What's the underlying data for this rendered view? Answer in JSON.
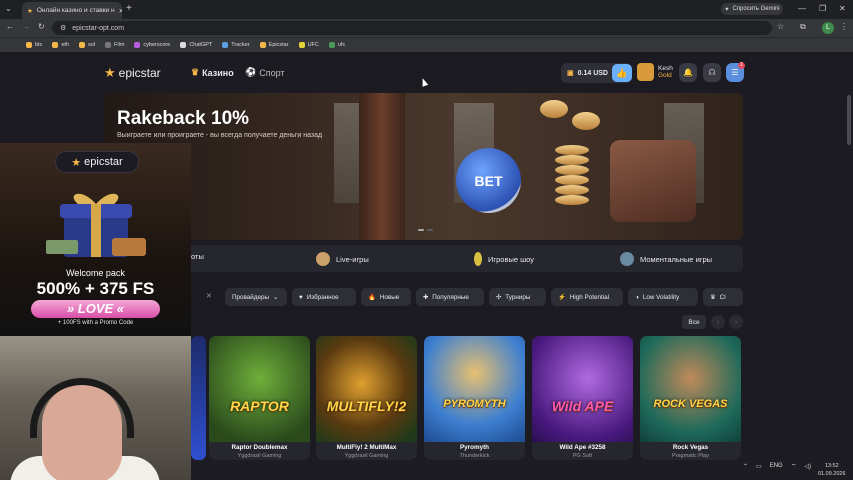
{
  "browser": {
    "tab_title": "Онлайн казино и ставки н",
    "url": "epicstar-opt.com",
    "gemini_label": "Спросить Gemini",
    "bookmarks": [
      "btc",
      "eth",
      "sol",
      "Film",
      "cyberscore",
      "ChatGPT",
      "Tracker",
      "Epicstar",
      "UFC",
      "ufc"
    ]
  },
  "site": {
    "logo": "epicstar",
    "nav": {
      "casino": "Казино",
      "sport": "Спорт"
    },
    "balance": "0.14 USD",
    "user": {
      "name": "Kesh",
      "level": "Gold"
    },
    "notification_count": "1"
  },
  "hero": {
    "title": "Rakeback 10%",
    "subtitle": "Выиграете или проиграете - вы всегда получаете деньги назад",
    "coin_text": "BET"
  },
  "categories": [
    {
      "label": "оты"
    },
    {
      "label": "Live-игры"
    },
    {
      "label": "Игровые шоу"
    },
    {
      "label": "Моментальные игры"
    }
  ],
  "filters": {
    "clear": "✕",
    "providers": "Провайдеры",
    "chips": [
      "Избранное",
      "Новые",
      "Популярные",
      "Турниры",
      "High Potential",
      "Low Volatility",
      "Cl"
    ]
  },
  "games_nav": {
    "all": "Все"
  },
  "games": [
    {
      "title": "Raptor Doublemax",
      "provider": "Yggdrasil Gaming",
      "logo": "RAPTOR",
      "bg": "#3f6f2a"
    },
    {
      "title": "MultiFly! 2 MultiMax",
      "provider": "Yggdrasil Gaming",
      "logo": "MULTIFLY!2",
      "bg": "#2c6c3a"
    },
    {
      "title": "Pyromyth",
      "provider": "Thunderkick",
      "logo": "PYROMYTH",
      "bg": "#2a6fb5"
    },
    {
      "title": "Wild Ape #3258",
      "provider": "PG Soft",
      "logo": "Wild APE",
      "bg": "#6a2fa8"
    },
    {
      "title": "Rock Vegas",
      "provider": "Pragmatic Play",
      "logo": "ROCK VEGAS",
      "bg": "#1f7a6a"
    }
  ],
  "promo": {
    "logo": "epicstar",
    "welcome": "Welcome pack",
    "bonus": "500% + 375 FS",
    "code": "» LOVE «",
    "note": "+ 100FS with a Promo Code"
  },
  "taskbar": {
    "lang": "ENG",
    "time": "13:52",
    "date": "01.09.2026"
  }
}
